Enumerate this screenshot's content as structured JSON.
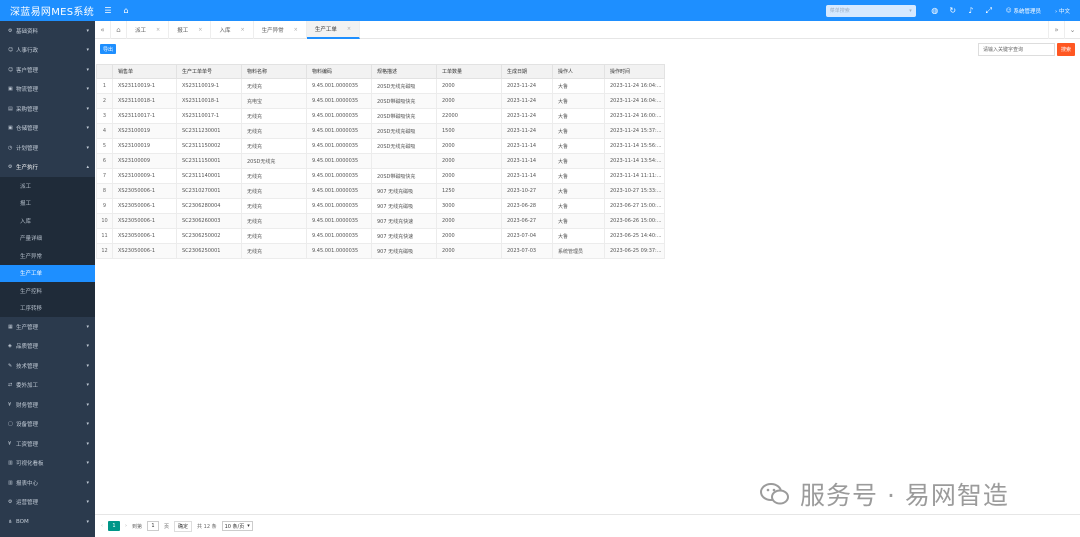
{
  "header": {
    "brand": "深蓝易网MES系统",
    "menu_search_placeholder": "菜单搜索",
    "user": "系统管理员",
    "lang": "中文"
  },
  "sidebar": {
    "items": [
      {
        "label": "基础资料",
        "icon": "gear-icon"
      },
      {
        "label": "人事行政",
        "icon": "user-icon"
      },
      {
        "label": "客户管理",
        "icon": "user-icon"
      },
      {
        "label": "物流管理",
        "icon": "box-icon"
      },
      {
        "label": "采购管理",
        "icon": "cart-icon"
      },
      {
        "label": "仓储管理",
        "icon": "box-icon"
      },
      {
        "label": "计划管理",
        "icon": "calendar-icon"
      },
      {
        "label": "生产执行",
        "icon": "gear-icon"
      }
    ],
    "subitems": [
      "派工",
      "报工",
      "入库",
      "产量详细",
      "生产异常",
      "生产工单",
      "生产控料",
      "工序转移"
    ],
    "bottom_items": [
      {
        "label": "生产管理",
        "icon": "grid-icon"
      },
      {
        "label": "品质管理",
        "icon": "shield-icon"
      },
      {
        "label": "技术管理",
        "icon": "tool-icon"
      },
      {
        "label": "委外加工",
        "icon": "share-icon"
      },
      {
        "label": "财务管理",
        "icon": "money-icon"
      },
      {
        "label": "设备管理",
        "icon": "device-icon"
      },
      {
        "label": "工资管理",
        "icon": "money-icon"
      },
      {
        "label": "可视化看板",
        "icon": "chart-icon"
      },
      {
        "label": "报表中心",
        "icon": "chart-icon"
      },
      {
        "label": "运营管理",
        "icon": "gear-icon"
      },
      {
        "label": "BOM",
        "icon": "tree-icon"
      }
    ]
  },
  "tabs": [
    "派工",
    "报工",
    "入库",
    "生产异常",
    "生产工单"
  ],
  "toolbar": {
    "export_label": "导出",
    "search_placeholder": "请输入关键字查询",
    "search_label": "搜索"
  },
  "table": {
    "columns": [
      "",
      "销售单",
      "生产工单单号",
      "物料名称",
      "物料编码",
      "规格描述",
      "工单数量",
      "生成日期",
      "操作人",
      "操作时间"
    ],
    "rows": [
      [
        "1",
        "XS23110019-1",
        "XS23110019-1",
        "无线充",
        "9.45.001.0000035",
        "20SD无线充磁吸",
        "2000",
        "2023-11-24",
        "大鲁",
        "2023-11-24 16:04:..."
      ],
      [
        "2",
        "XS23110018-1",
        "XS23110018-1",
        "充电宝",
        "9.45.001.0000035",
        "20SD带磁吸快充",
        "2000",
        "2023-11-24",
        "大鲁",
        "2023-11-24 16:04:..."
      ],
      [
        "3",
        "XS23110017-1",
        "XS23110017-1",
        "无线充",
        "9.45.001.0000035",
        "20SD带磁吸快充",
        "22000",
        "2023-11-24",
        "大鲁",
        "2023-11-24 16:00:..."
      ],
      [
        "4",
        "XS23100019",
        "SC2311230001",
        "无线充",
        "9.45.001.0000035",
        "20SD无线充磁吸",
        "1500",
        "2023-11-24",
        "大鲁",
        "2023-11-24 15:37:..."
      ],
      [
        "5",
        "XS23100019",
        "SC2311150002",
        "无线充",
        "9.45.001.0000035",
        "20SD无线充磁吸",
        "2000",
        "2023-11-14",
        "大鲁",
        "2023-11-14 15:56:..."
      ],
      [
        "6",
        "XS23100009",
        "SC2311150001",
        "20SD无线充",
        "9.45.001.0000035",
        "",
        "2000",
        "2023-11-14",
        "大鲁",
        "2023-11-14 13:54:..."
      ],
      [
        "7",
        "XS23100009-1",
        "SC2311140001",
        "无线充",
        "9.45.001.0000035",
        "20SD带磁吸快充",
        "2000",
        "2023-11-14",
        "大鲁",
        "2023-11-14 11:11:..."
      ],
      [
        "8",
        "XS23050006-1",
        "SC2310270001",
        "无线充",
        "9.45.001.0000035",
        "907 无线充磁吸",
        "1250",
        "2023-10-27",
        "大鲁",
        "2023-10-27 15:33:..."
      ],
      [
        "9",
        "XS23050006-1",
        "SC2306280004",
        "无线充",
        "9.45.001.0000035",
        "907 无线充磁吸",
        "3000",
        "2023-06-28",
        "大鲁",
        "2023-06-27 15:00:..."
      ],
      [
        "10",
        "XS23050006-1",
        "SC2306260003",
        "无线充",
        "9.45.001.0000035",
        "907 无线充快速",
        "2000",
        "2023-06-27",
        "大鲁",
        "2023-06-26 15:00:..."
      ],
      [
        "11",
        "XS23050006-1",
        "SC2306250002",
        "无线充",
        "9.45.001.0000035",
        "907 无线充快速",
        "2000",
        "2023-07-04",
        "大鲁",
        "2023-06-25 14:40:..."
      ],
      [
        "12",
        "XS23050006-1",
        "SC2306250001",
        "无线充",
        "9.45.001.0000035",
        "907 无线充磁吸",
        "2000",
        "2023-07-03",
        "系统管理员",
        "2023-06-25 09:37:..."
      ]
    ]
  },
  "pager": {
    "prev": "上一页",
    "current": "1",
    "next": "下一页",
    "goto_label": "到第",
    "goto_value": "1",
    "page_unit": "页",
    "go_label": "确定",
    "total": "共 12 条",
    "page_size": "10 条/页"
  },
  "watermark": {
    "text": "服务号 · 易网智造"
  }
}
